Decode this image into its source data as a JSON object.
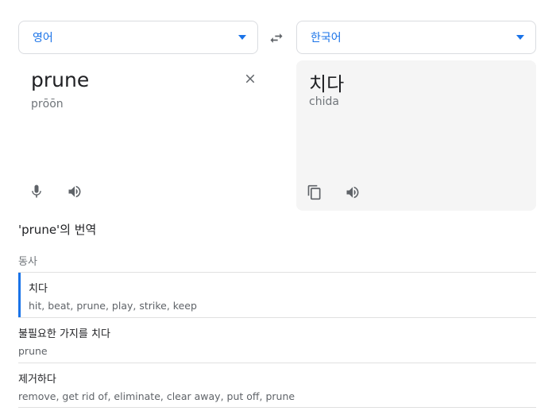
{
  "source_language": {
    "label": "영어"
  },
  "target_language": {
    "label": "한국어"
  },
  "icons": {
    "swap": "swap-arrows-icon",
    "clear": "close-icon",
    "mic": "microphone-icon",
    "speaker": "speaker-icon",
    "copy": "copy-icon",
    "dropdown": "caret-down-icon"
  },
  "source": {
    "text": "prune",
    "transliteration": "prōōn"
  },
  "target": {
    "text": "치다",
    "transliteration": "chida"
  },
  "dictionary": {
    "heading": "'prune'의 번역",
    "part_of_speech": "동사",
    "entries": [
      {
        "term": "치다",
        "synonyms": "hit, beat, prune, play, strike, keep"
      },
      {
        "term": "불필요한 가지를 치다",
        "synonyms": "prune"
      },
      {
        "term": "제거하다",
        "synonyms": "remove, get rid of, eliminate, clear away, put off, prune"
      }
    ]
  },
  "colors": {
    "accent": "#1a73e8",
    "icon": "#5f6368",
    "muted": "#70757a",
    "panel": "#f5f5f5"
  }
}
